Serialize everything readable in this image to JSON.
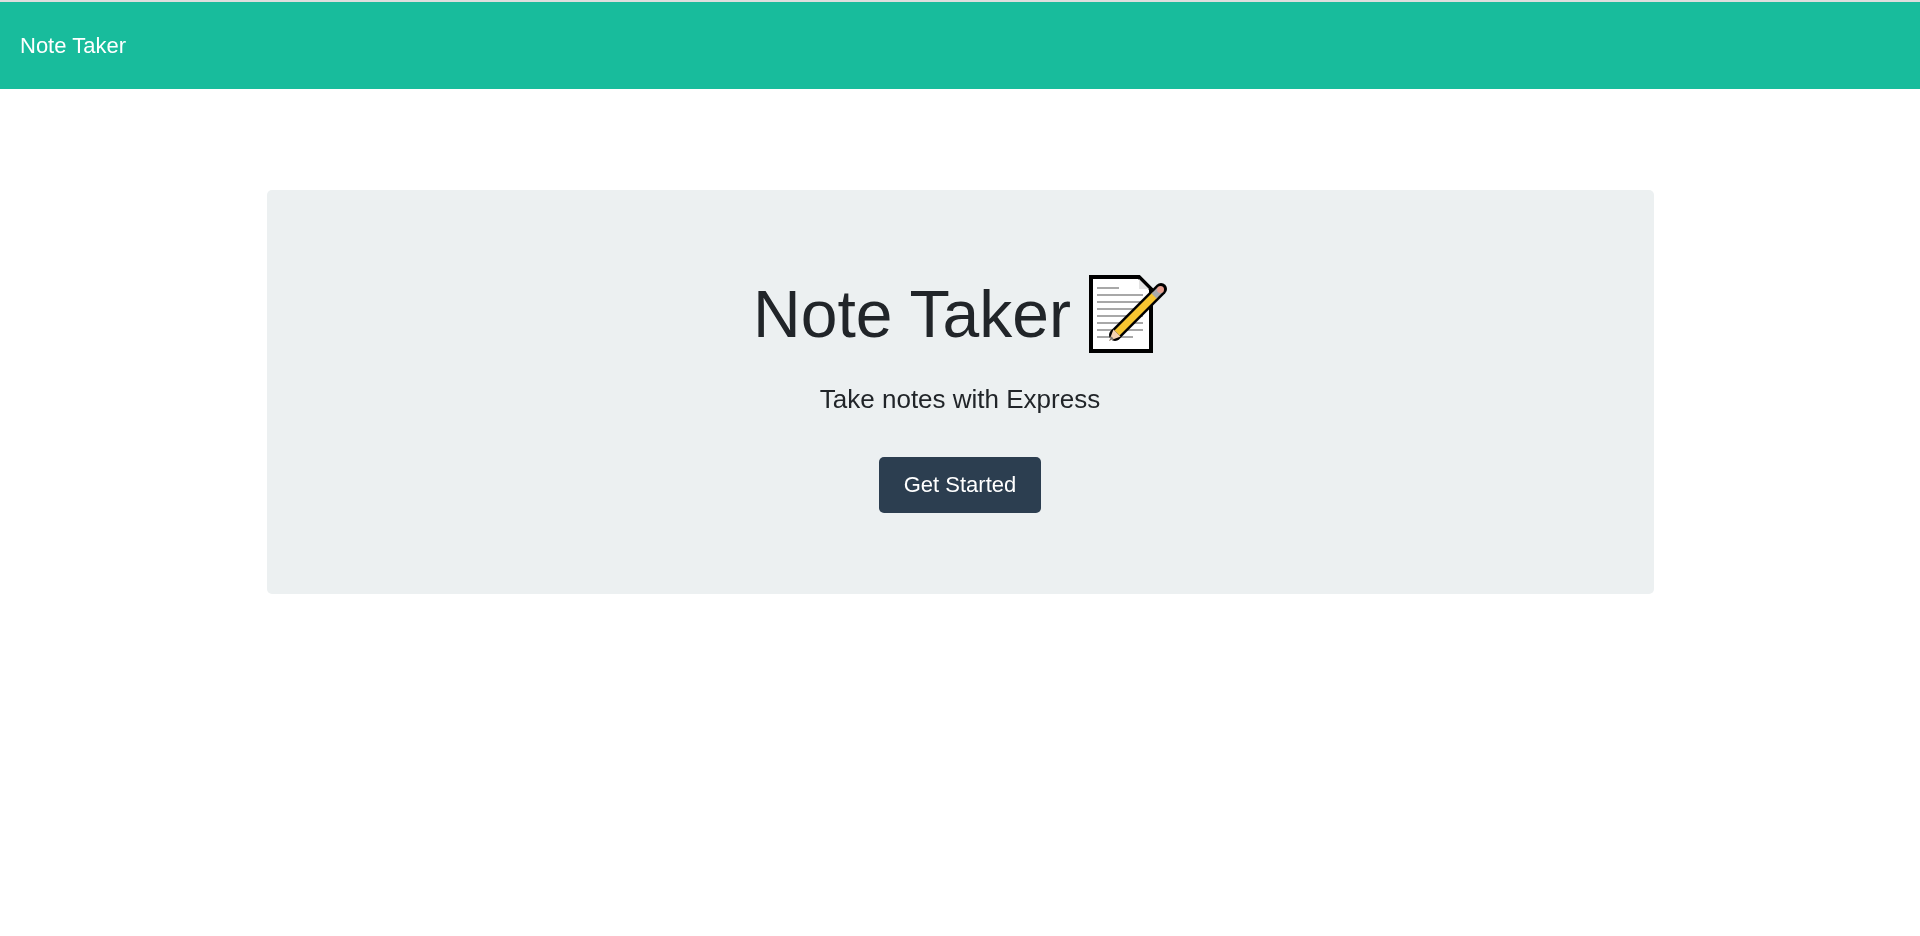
{
  "navbar": {
    "brand": "Note Taker"
  },
  "hero": {
    "title": "Note Taker",
    "subtitle": "Take notes with Express",
    "button": "Get Started"
  }
}
